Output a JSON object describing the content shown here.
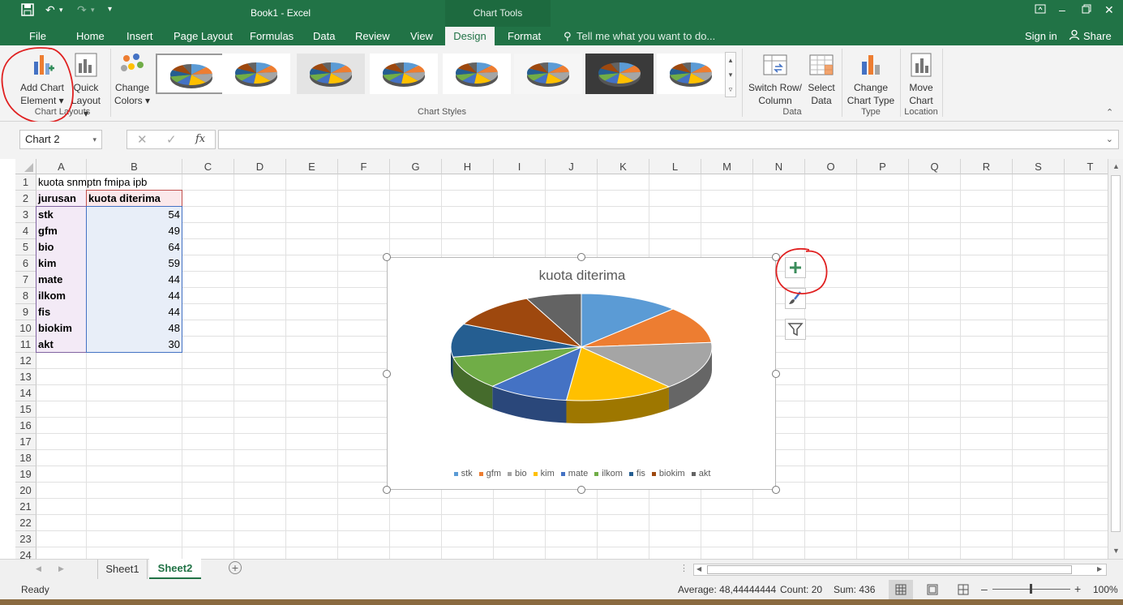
{
  "title_bar": {
    "doc_title": "Book1 - Excel",
    "contextual_group": "Chart Tools",
    "sign_in": "Sign in",
    "share": "Share",
    "tell_me": "Tell me what you want to do..."
  },
  "tabs": [
    "File",
    "Home",
    "Insert",
    "Page Layout",
    "Formulas",
    "Data",
    "Review",
    "View",
    "Design",
    "Format"
  ],
  "active_tab": "Design",
  "ribbon": {
    "add_chart_element": [
      "Add Chart",
      "Element ▾"
    ],
    "quick_layout": [
      "Quick",
      "Layout ▾"
    ],
    "change_colors": [
      "Change",
      "Colors ▾"
    ],
    "switch_row_column": [
      "Switch Row/",
      "Column"
    ],
    "select_data": [
      "Select",
      "Data"
    ],
    "change_chart_type": [
      "Change",
      "Chart Type"
    ],
    "move_chart": [
      "Move",
      "Chart"
    ],
    "groups": {
      "chart_layouts": "Chart Layouts",
      "chart_styles": "Chart Styles",
      "data": "Data",
      "type": "Type",
      "location": "Location"
    }
  },
  "formula_bar": {
    "name_box": "Chart 2",
    "fx": "fx",
    "formula": ""
  },
  "columns": [
    "A",
    "B",
    "C",
    "D",
    "E",
    "F",
    "G",
    "H",
    "I",
    "J",
    "K",
    "L",
    "M",
    "N",
    "O",
    "P",
    "Q",
    "R",
    "S",
    "T"
  ],
  "rows": [
    "1",
    "2",
    "3",
    "4",
    "5",
    "6",
    "7",
    "8",
    "9",
    "10",
    "11",
    "12",
    "13",
    "14",
    "15",
    "16",
    "17",
    "18",
    "19",
    "20",
    "21",
    "22",
    "23",
    "24"
  ],
  "sheet": {
    "a1": "kuota snmptn fmipa ipb",
    "header": [
      "jurusan",
      "kuota diterima"
    ],
    "data": [
      {
        "jurusan": "stk",
        "kuota": "54"
      },
      {
        "jurusan": "gfm",
        "kuota": "49"
      },
      {
        "jurusan": "bio",
        "kuota": "64"
      },
      {
        "jurusan": "kim",
        "kuota": "59"
      },
      {
        "jurusan": "mate",
        "kuota": "44"
      },
      {
        "jurusan": "ilkom",
        "kuota": "44"
      },
      {
        "jurusan": "fis",
        "kuota": "44"
      },
      {
        "jurusan": "biokim",
        "kuota": "48"
      },
      {
        "jurusan": "akt",
        "kuota": "30"
      }
    ]
  },
  "chart_data": {
    "type": "pie",
    "title": "kuota diterima",
    "categories": [
      "stk",
      "gfm",
      "bio",
      "kim",
      "mate",
      "ilkom",
      "fis",
      "biokim",
      "akt"
    ],
    "values": [
      54,
      49,
      64,
      59,
      44,
      44,
      44,
      48,
      30
    ],
    "colors": [
      "#5b9bd5",
      "#ed7d31",
      "#a5a5a5",
      "#ffc000",
      "#4472c4",
      "#70ad47",
      "#255e91",
      "#9e480e",
      "#636363"
    ],
    "legend": "bottom",
    "style": "3d"
  },
  "sheet_tabs": [
    "Sheet1",
    "Sheet2"
  ],
  "active_sheet": "Sheet2",
  "status": {
    "ready": "Ready",
    "average": "Average: 48,44444444",
    "count": "Count: 20",
    "sum": "Sum: 436",
    "zoom": "100%"
  }
}
